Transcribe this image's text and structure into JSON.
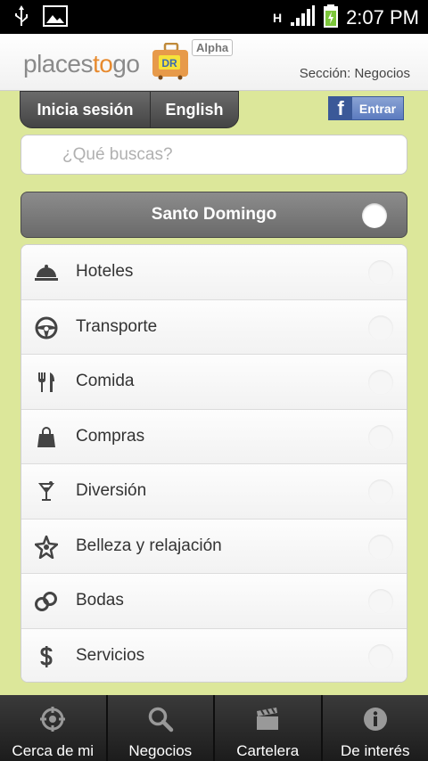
{
  "status": {
    "time": "2:07 PM",
    "network": "H"
  },
  "header": {
    "logo_a": "places",
    "logo_b": "to",
    "logo_c": "go",
    "badge_text": "DR",
    "alpha": "Alpha",
    "section": "Sección: Negocios"
  },
  "auth": {
    "login": "Inicia sesión",
    "language": "English",
    "facebook_letter": "f",
    "facebook": "Entrar"
  },
  "search": {
    "placeholder": "¿Qué buscas?"
  },
  "city": {
    "label": "Santo Domingo"
  },
  "categories": [
    {
      "label": "Hoteles",
      "icon": "cloche-icon"
    },
    {
      "label": "Transporte",
      "icon": "steering-wheel-icon"
    },
    {
      "label": "Comida",
      "icon": "fork-knife-icon"
    },
    {
      "label": "Compras",
      "icon": "shopping-bag-icon"
    },
    {
      "label": "Diversión",
      "icon": "cocktail-icon"
    },
    {
      "label": "Belleza y relajación",
      "icon": "star-icon"
    },
    {
      "label": "Bodas",
      "icon": "rings-icon"
    },
    {
      "label": "Servicios",
      "icon": "dollar-icon"
    }
  ],
  "nav": [
    {
      "label": "Cerca de mi",
      "icon": "crosshair-icon"
    },
    {
      "label": "Negocios",
      "icon": "search-icon"
    },
    {
      "label": "Cartelera",
      "icon": "clapperboard-icon"
    },
    {
      "label": "De interés",
      "icon": "info-icon"
    }
  ],
  "colors": {
    "background": "#dce79a",
    "accent": "#e78a2e",
    "nav": "#2a2a2a"
  }
}
